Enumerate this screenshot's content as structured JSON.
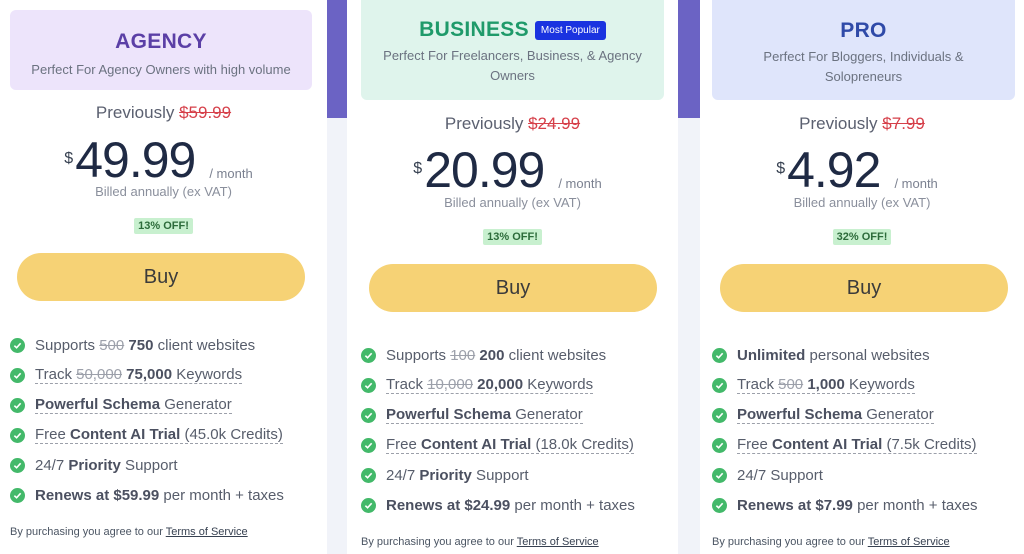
{
  "plans": [
    {
      "name": "AGENCY",
      "tagline": "Perfect For Agency Owners with high volume",
      "previously_label": "Previously",
      "old_price": "$59.99",
      "currency": "$",
      "price": "49.99",
      "period": "/ month",
      "billed": "Billed annually (ex VAT)",
      "discount": "13% OFF!",
      "buy_label": "Buy",
      "features": [
        {
          "pre": "Supports ",
          "strike": "500",
          "bold": " 750",
          "post": " client websites",
          "dotted": false
        },
        {
          "pre": "Track ",
          "strike": "50,000",
          "bold": " 75,000",
          "post": " Keywords",
          "dotted": true
        },
        {
          "pre": "",
          "strike": "",
          "bold": "Powerful Schema",
          "post": " Generator",
          "dotted": true
        },
        {
          "pre": "Free ",
          "strike": "",
          "bold": "Content AI Trial",
          "post": " (45.0k Credits)",
          "dotted": true
        },
        {
          "pre": "24/7 ",
          "strike": "",
          "bold": "Priority",
          "post": " Support",
          "dotted": false
        },
        {
          "pre": "",
          "strike": "",
          "bold": "Renews at $59.99",
          "post": " per month + taxes",
          "dotted": false
        }
      ],
      "terms_text": "By purchasing you agree to our ",
      "terms_link": "Terms of Service"
    },
    {
      "name": "BUSINESS",
      "badge": "Most Popular",
      "tagline": "Perfect For Freelancers, Business, & Agency Owners",
      "previously_label": "Previously",
      "old_price": "$24.99",
      "currency": "$",
      "price": "20.99",
      "period": "/ month",
      "billed": "Billed annually (ex VAT)",
      "discount": "13% OFF!",
      "buy_label": "Buy",
      "features": [
        {
          "pre": "Supports ",
          "strike": "100",
          "bold": " 200",
          "post": " client websites",
          "dotted": false
        },
        {
          "pre": "Track ",
          "strike": "10,000",
          "bold": " 20,000",
          "post": " Keywords",
          "dotted": true
        },
        {
          "pre": "",
          "strike": "",
          "bold": "Powerful Schema",
          "post": " Generator",
          "dotted": true
        },
        {
          "pre": "Free ",
          "strike": "",
          "bold": "Content AI Trial",
          "post": " (18.0k Credits)",
          "dotted": true
        },
        {
          "pre": "24/7 ",
          "strike": "",
          "bold": "Priority",
          "post": " Support",
          "dotted": false
        },
        {
          "pre": "",
          "strike": "",
          "bold": "Renews at $24.99",
          "post": " per month + taxes",
          "dotted": false
        }
      ],
      "terms_text": "By purchasing you agree to our ",
      "terms_link": "Terms of Service"
    },
    {
      "name": "PRO",
      "tagline": "Perfect For Bloggers, Individuals & Solopreneurs",
      "previously_label": "Previously",
      "old_price": "$7.99",
      "currency": "$",
      "price": "4.92",
      "period": "/ month",
      "billed": "Billed annually (ex VAT)",
      "discount": "32% OFF!",
      "buy_label": "Buy",
      "features": [
        {
          "pre": "",
          "strike": "",
          "bold": "Unlimited",
          "post": " personal websites",
          "dotted": false
        },
        {
          "pre": "Track ",
          "strike": "500",
          "bold": " 1,000",
          "post": " Keywords",
          "dotted": true
        },
        {
          "pre": "",
          "strike": "",
          "bold": "Powerful Schema",
          "post": " Generator",
          "dotted": true
        },
        {
          "pre": "Free ",
          "strike": "",
          "bold": "Content AI Trial",
          "post": " (7.5k Credits)",
          "dotted": true
        },
        {
          "pre": "24/7 ",
          "strike": "",
          "bold": "",
          "post": "Support",
          "dotted": false
        },
        {
          "pre": "",
          "strike": "",
          "bold": "Renews at $7.99",
          "post": " per month + taxes",
          "dotted": false
        }
      ],
      "terms_text": "By purchasing you agree to our ",
      "terms_link": "Terms of Service"
    }
  ],
  "colors": {
    "accent_band": "#6b63c4",
    "buy_button": "#f6d275",
    "check": "#43b96a",
    "old_price": "#d6404a",
    "badge": "#1a33e0"
  }
}
